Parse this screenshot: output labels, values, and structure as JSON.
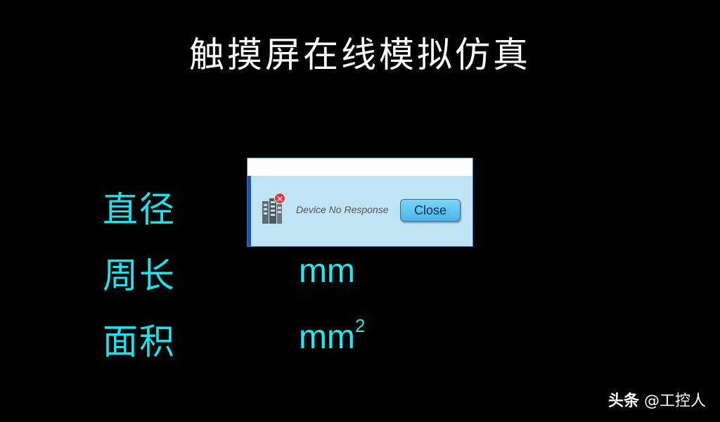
{
  "title": "触摸屏在线模拟仿真",
  "rows": [
    {
      "label": "直径",
      "unit": ""
    },
    {
      "label": "周长",
      "unit": "mm"
    },
    {
      "label": "面积",
      "unit": "mm",
      "unit_sup": "2"
    }
  ],
  "dialog": {
    "message": "Device No Response",
    "close_label": "Close",
    "icon": "device-error-icon",
    "badge_icon": "close-x-icon"
  },
  "watermark": {
    "brand": "头条",
    "handle": "@工控人"
  },
  "colors": {
    "background": "#000000",
    "title": "#ffffff",
    "label": "#22e0ea",
    "dialog_body": "#bfe4f3",
    "dialog_accent": "#1f57b0",
    "error_badge": "#e2394d"
  }
}
